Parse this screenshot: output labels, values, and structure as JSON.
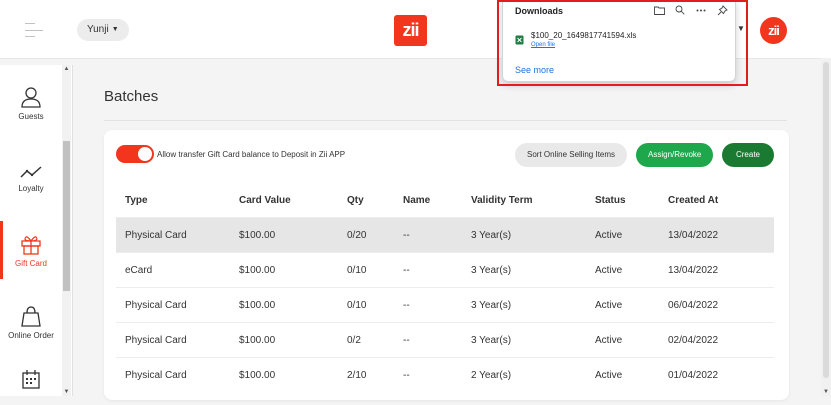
{
  "header": {
    "store_name": "Yunji",
    "logo_text": "zii",
    "avatar_text": "zii"
  },
  "sidebar": {
    "items": [
      {
        "label": "Guests",
        "icon": "person-icon"
      },
      {
        "label": "Loyalty",
        "icon": "trend-icon"
      },
      {
        "label": "Gift Card",
        "icon": "gift-icon"
      },
      {
        "label": "Online Order",
        "icon": "shopping-bag-icon"
      },
      {
        "label": "",
        "icon": "calendar-icon"
      }
    ]
  },
  "page": {
    "title": "Batches"
  },
  "toolbar": {
    "toggle_label": "Allow transfer Gift Card balance to Deposit in Zii APP",
    "sort_label": "Sort Online Selling Items",
    "assign_label": "Assign/Revoke",
    "create_label": "Create"
  },
  "table": {
    "headers": [
      "Type",
      "Card Value",
      "Qty",
      "Name",
      "Validity Term",
      "Status",
      "Created At"
    ],
    "rows": [
      [
        "Physical Card",
        "$100.00",
        "0/20",
        "--",
        "3 Year(s)",
        "Active",
        "13/04/2022"
      ],
      [
        "eCard",
        "$100.00",
        "0/10",
        "--",
        "3 Year(s)",
        "Active",
        "13/04/2022"
      ],
      [
        "Physical Card",
        "$100.00",
        "0/10",
        "--",
        "3 Year(s)",
        "Active",
        "06/04/2022"
      ],
      [
        "Physical Card",
        "$100.00",
        "0/2",
        "--",
        "3 Year(s)",
        "Active",
        "02/04/2022"
      ],
      [
        "Physical Card",
        "$100.00",
        "2/10",
        "--",
        "2 Year(s)",
        "Active",
        "01/04/2022"
      ]
    ]
  },
  "downloads": {
    "title": "Downloads",
    "file_name": "$100_20_1649817741594.xls",
    "open_label": "Open file",
    "see_more": "See more"
  },
  "colors": {
    "brand": "#f1361d",
    "assign": "#1fa74b",
    "create": "#1a7a32",
    "highlight_outline": "#e01e1e"
  }
}
